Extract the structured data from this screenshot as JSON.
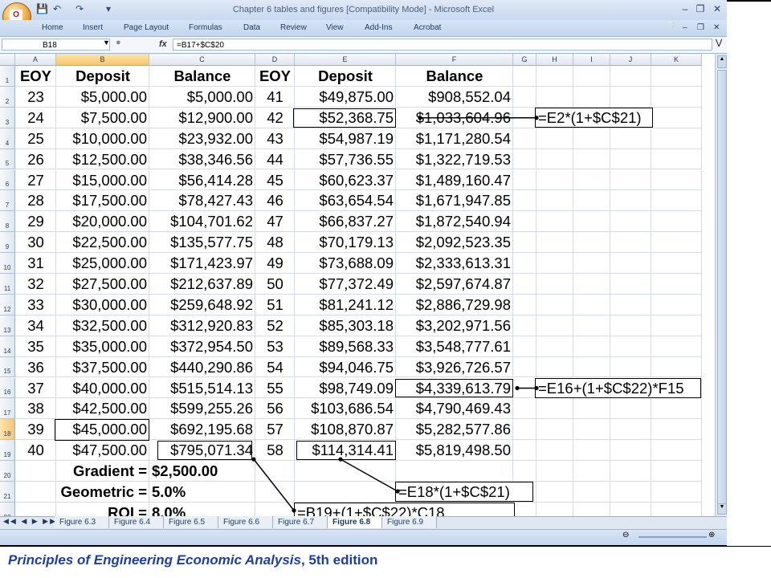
{
  "window": {
    "title": "Chapter 6 tables and figures  [Compatibility Mode]  -  Microsoft Excel",
    "office_logo": "O"
  },
  "ribbon": {
    "tabs": [
      "Home",
      "Insert",
      "Page Layout",
      "Formulas",
      "Data",
      "Review",
      "View",
      "Add-Ins",
      "Acrobat"
    ]
  },
  "formula_bar": {
    "name_box": "B18",
    "fx": "fx",
    "formula": "=B17+$C$20"
  },
  "columns": [
    "A",
    "B",
    "C",
    "D",
    "E",
    "F",
    "G",
    "H",
    "I",
    "J",
    "K"
  ],
  "rows": [
    "1",
    "2",
    "3",
    "4",
    "5",
    "6",
    "7",
    "8",
    "9",
    "10",
    "11",
    "12",
    "13",
    "14",
    "15",
    "16",
    "17",
    "18",
    "19",
    "20",
    "21",
    "22"
  ],
  "headers": {
    "eoy1": "EOY",
    "deposit1": "Deposit",
    "balance1": "Balance",
    "eoy2": "EOY",
    "deposit2": "Deposit",
    "balance2": "Balance"
  },
  "table": [
    [
      "23",
      "$5,000.00",
      "$5,000.00",
      "41",
      "$49,875.00",
      "$908,552.04"
    ],
    [
      "24",
      "$7,500.00",
      "$12,900.00",
      "42",
      "$52,368.75",
      "$1,033,604.96"
    ],
    [
      "25",
      "$10,000.00",
      "$23,932.00",
      "43",
      "$54,987.19",
      "$1,171,280.54"
    ],
    [
      "26",
      "$12,500.00",
      "$38,346.56",
      "44",
      "$57,736.55",
      "$1,322,719.53"
    ],
    [
      "27",
      "$15,000.00",
      "$56,414.28",
      "45",
      "$60,623.37",
      "$1,489,160.47"
    ],
    [
      "28",
      "$17,500.00",
      "$78,427.43",
      "46",
      "$63,654.54",
      "$1,671,947.85"
    ],
    [
      "29",
      "$20,000.00",
      "$104,701.62",
      "47",
      "$66,837.27",
      "$1,872,540.94"
    ],
    [
      "30",
      "$22,500.00",
      "$135,577.75",
      "48",
      "$70,179.13",
      "$2,092,523.35"
    ],
    [
      "31",
      "$25,000.00",
      "$171,423.97",
      "49",
      "$73,688.09",
      "$2,333,613.31"
    ],
    [
      "32",
      "$27,500.00",
      "$212,637.89",
      "50",
      "$77,372.49",
      "$2,597,674.87"
    ],
    [
      "33",
      "$30,000.00",
      "$259,648.92",
      "51",
      "$81,241.12",
      "$2,886,729.98"
    ],
    [
      "34",
      "$32,500.00",
      "$312,920.83",
      "52",
      "$85,303.18",
      "$3,202,971.56"
    ],
    [
      "35",
      "$35,000.00",
      "$372,954.50",
      "53",
      "$89,568.33",
      "$3,548,777.61"
    ],
    [
      "36",
      "$37,500.00",
      "$440,290.86",
      "54",
      "$94,046.75",
      "$3,926,726.57"
    ],
    [
      "37",
      "$40,000.00",
      "$515,514.13",
      "55",
      "$98,749.09",
      "$4,339,613.79"
    ],
    [
      "38",
      "$42,500.00",
      "$599,255.26",
      "56",
      "$103,686.54",
      "$4,790,469.43"
    ],
    [
      "39",
      "$45,000.00",
      "$692,195.68",
      "57",
      "$108,870.87",
      "$5,282,577.86"
    ],
    [
      "40",
      "$47,500.00",
      "$795,071.34",
      "58",
      "$114,314.41",
      "$5,819,498.50"
    ]
  ],
  "params": [
    {
      "label": "Gradient =",
      "value": "$2,500.00"
    },
    {
      "label": "Geometric =",
      "value": "5.0%"
    },
    {
      "label": "ROI =",
      "value": "8.0%"
    }
  ],
  "annotations": {
    "e3": "=E2*(1+$C$21)",
    "f16": "=E16+(1+$C$22)*F15",
    "e19": "=E18*(1+$C$21)",
    "c19": "=B19+(1+$C$22)*C18"
  },
  "sheet_tabs": [
    "Figure 6.3",
    "Figure 6.4",
    "Figure 6.5",
    "Figure 6.6",
    "Figure 6.7",
    "Figure 6.8",
    "Figure 6.9"
  ],
  "active_sheet": "Figure 6.8",
  "footer": {
    "title": "Principles of Engineering Economic Analysis",
    "edition": ", 5th edition"
  },
  "colors": {
    "accent": "#1f3fa0",
    "selected_header": "#f5c66b"
  }
}
